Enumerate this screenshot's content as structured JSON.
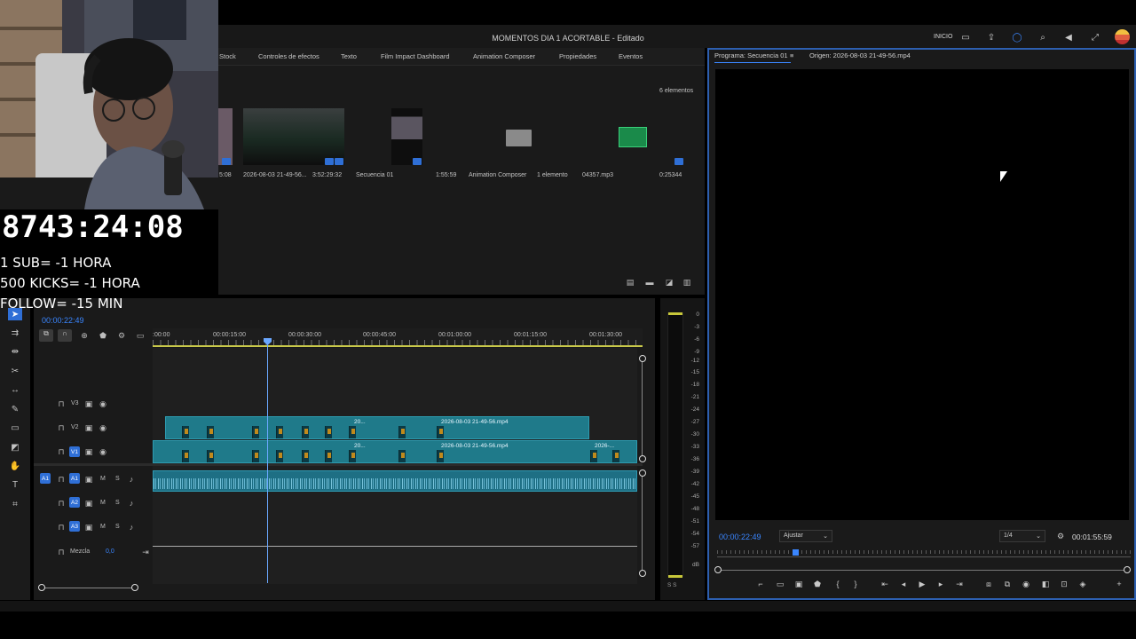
{
  "window": {
    "title": "MOMENTOS DIA 1 ACORTABLE - Editado",
    "home_label": "INICIO"
  },
  "project_tabs": [
    "Stock",
    "Controles de efectos",
    "Texto",
    "Film Impact Dashboard",
    "Animation Composer",
    "Propiedades",
    "Eventos"
  ],
  "project": {
    "count": "6 elementos",
    "items": [
      {
        "name": "5:08",
        "duration": ""
      },
      {
        "name": "2026-08-03 21-49-56...",
        "duration": "3:52:29:32"
      },
      {
        "name": "Secuencia 01",
        "duration": "1:55:59"
      },
      {
        "name": "Animation Composer",
        "duration": "1 elemento"
      },
      {
        "name": "04357.mp3",
        "duration": "0:25344"
      }
    ]
  },
  "program_monitor": {
    "tab_program": "Programa: Secuencia 01",
    "tab_source": "Origen: 2026-08-03 21-49-56.mp4",
    "timecode": "00:00:22:49",
    "fit": "Ajustar",
    "resolution": "1/4",
    "duration": "00:01:55:59"
  },
  "timeline": {
    "timecode": "00:00:22:49",
    "ruler": [
      ":00:00",
      "00:00:15:00",
      "00:00:30:00",
      "00:00:45:00",
      "00:01:00:00",
      "00:01:15:00",
      "00:01:30:00"
    ],
    "tracks": {
      "v3": "V3",
      "v2": "V2",
      "v1": "V1",
      "a1": "A1",
      "a2": "A2",
      "a3": "A3",
      "src_a1": "A1",
      "m": "M",
      "s": "S",
      "mix": "Mezcla",
      "mix_value": "0,0"
    },
    "clip_v2_label": "2026-08-03 21-49-56.mp4",
    "clip_v1_label": "2026-08-03 21-49-56.mp4",
    "clip_v1_end": "2026-...",
    "short_label": "20..."
  },
  "meter": {
    "scale": [
      "0",
      "-3",
      "-6",
      "-9",
      "-12",
      "-15",
      "-18",
      "-21",
      "-24",
      "-27",
      "-30",
      "-33",
      "-36",
      "-39",
      "-42",
      "-45",
      "-48",
      "-51",
      "-54",
      "-57",
      "dB"
    ],
    "bottom": "S S"
  },
  "overlay": {
    "counter": "8743:24:08",
    "line1": "1 SUB= -1 HORA",
    "line2": "500 KICKS= -1 HORA",
    "line3": "FOLLOW= -15 MIN"
  }
}
